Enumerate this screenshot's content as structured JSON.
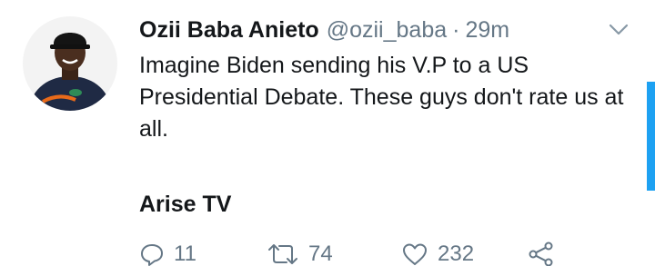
{
  "tweet": {
    "display_name": "Ozii Baba Anieto",
    "handle": "@ozii_baba",
    "separator": "·",
    "time": "29m",
    "text": "Imagine Biden sending his V.P to a US Presidential Debate. These guys don't rate us at all.",
    "quote_title": "Arise TV"
  },
  "actions": {
    "reply_count": "11",
    "retweet_count": "74",
    "like_count": "232"
  },
  "icons": {
    "avatar": "profile-photo",
    "menu": "chevron-down-icon",
    "reply": "reply-icon",
    "retweet": "retweet-icon",
    "like": "heart-icon",
    "share": "share-icon"
  },
  "colors": {
    "text": "#14171a",
    "secondary": "#657786",
    "accent": "#1da1f2"
  }
}
